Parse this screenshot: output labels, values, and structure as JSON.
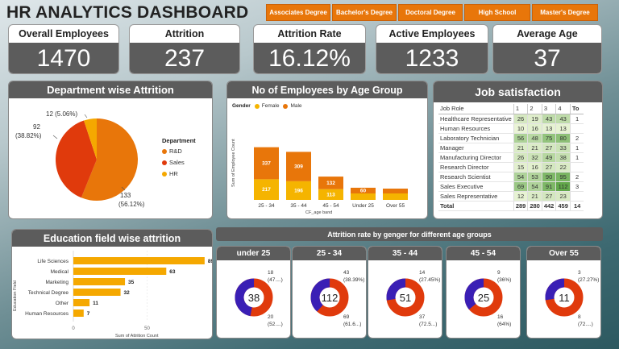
{
  "title": "HR ANALYTICS DASHBOARD",
  "filters": [
    "Associates Degree",
    "Bachelor's Degree",
    "Doctoral Degree",
    "High School",
    "Master's Degree"
  ],
  "kpis": [
    {
      "label": "Overall Employees",
      "value": "1470"
    },
    {
      "label": "Attrition",
      "value": "237"
    },
    {
      "label": "Attrition Rate",
      "value": "16.12%"
    },
    {
      "label": "Active Employees",
      "value": "1233"
    },
    {
      "label": "Average Age",
      "value": "37"
    }
  ],
  "dept": {
    "title": "Department wise Attrition",
    "legend_title": "Department",
    "colors": {
      "R&D": "#e8760a",
      "Sales": "#e03a0c",
      "HR": "#f5a800"
    },
    "labels": {
      "hr": "12 (5.06%)",
      "sales_a": "92",
      "sales_b": "(38.82%)",
      "rd_a": "133",
      "rd_b": "(56.12%)"
    }
  },
  "age_chart": {
    "title": "No of Employees by Age Group",
    "legend_title": "Gender",
    "ylabel": "Sum of Employee Count",
    "xlabel": "CF_age band",
    "colors": {
      "Female": "#f5b400",
      "Male": "#e8760a"
    }
  },
  "job_sat": {
    "title": "Job satisfaction",
    "headers": [
      "Job Role",
      "1",
      "2",
      "3",
      "4",
      "To"
    ],
    "rows": [
      [
        "Healthcare Representative",
        "26",
        "19",
        "43",
        "43",
        "1"
      ],
      [
        "Human Resources",
        "10",
        "16",
        "13",
        "13",
        ""
      ],
      [
        "Laboratory Technician",
        "56",
        "48",
        "75",
        "80",
        "2"
      ],
      [
        "Manager",
        "21",
        "21",
        "27",
        "33",
        "1"
      ],
      [
        "Manufacturing Director",
        "26",
        "32",
        "49",
        "38",
        "1"
      ],
      [
        "Research Director",
        "15",
        "16",
        "27",
        "22",
        ""
      ],
      [
        "Research Scientist",
        "54",
        "53",
        "90",
        "95",
        "2"
      ],
      [
        "Sales Executive",
        "69",
        "54",
        "91",
        "112",
        "3"
      ],
      [
        "Sales Representative",
        "12",
        "21",
        "27",
        "23",
        ""
      ]
    ],
    "total": [
      "Total",
      "289",
      "280",
      "442",
      "459",
      "14"
    ]
  },
  "edu": {
    "title": "Education field wise attrition",
    "ylabel": "Education Field",
    "xlabel": "Sum of Attrition Count",
    "color": "#f5a800"
  },
  "gender_header": "Attrition rate by genger for different age groups",
  "donuts": [
    {
      "title": "under 25",
      "center": "38",
      "top_a": "18",
      "top_b": "(47....)",
      "bot_a": "20",
      "bot_b": "(52....)",
      "top_frac": 0.47
    },
    {
      "title": "25 - 34",
      "center": "112",
      "top_a": "43",
      "top_b": "(38.39%)",
      "bot_a": "69",
      "bot_b": "(61.6...)",
      "top_frac": 0.3839
    },
    {
      "title": "35 - 44",
      "center": "51",
      "top_a": "14",
      "top_b": "(27.45%)",
      "bot_a": "37",
      "bot_b": "(72.5...)",
      "top_frac": 0.2745
    },
    {
      "title": "45 - 54",
      "center": "25",
      "top_a": "9",
      "top_b": "(36%)",
      "bot_a": "16",
      "bot_b": "(64%)",
      "top_frac": 0.36
    },
    {
      "title": "Over 55",
      "center": "11",
      "top_a": "3",
      "top_b": "(27.27%)",
      "bot_a": "8",
      "bot_b": "(72....)",
      "top_frac": 0.2727
    }
  ],
  "donut_colors": {
    "top": "#3a1fb5",
    "bottom": "#e03a0c"
  },
  "chart_data": [
    {
      "type": "pie",
      "title": "Department wise Attrition",
      "categories": [
        "R&D",
        "Sales",
        "HR"
      ],
      "values": [
        133,
        92,
        12
      ],
      "legend": "right"
    },
    {
      "type": "bar",
      "title": "No of Employees by Age Group",
      "categories": [
        "25 - 34",
        "35 - 44",
        "45 - 54",
        "Under 25",
        "Over 55"
      ],
      "series": [
        {
          "name": "Female",
          "values": [
            217,
            196,
            113,
            null,
            null
          ]
        },
        {
          "name": "Male",
          "values": [
            337,
            309,
            132,
            60,
            null
          ]
        }
      ],
      "xlabel": "CF_age band",
      "ylabel": "Sum of Employee Count",
      "legend": "top-left"
    },
    {
      "type": "bar",
      "title": "Education field wise attrition",
      "categories": [
        "Life Sciences",
        "Medical",
        "Marketing",
        "Technical Degree",
        "Other",
        "Human Resources"
      ],
      "values": [
        89,
        63,
        35,
        32,
        11,
        7
      ],
      "xlabel": "Sum of Attrition Count",
      "ylabel": "Education Field",
      "xticks": [
        "0",
        "50"
      ]
    }
  ]
}
